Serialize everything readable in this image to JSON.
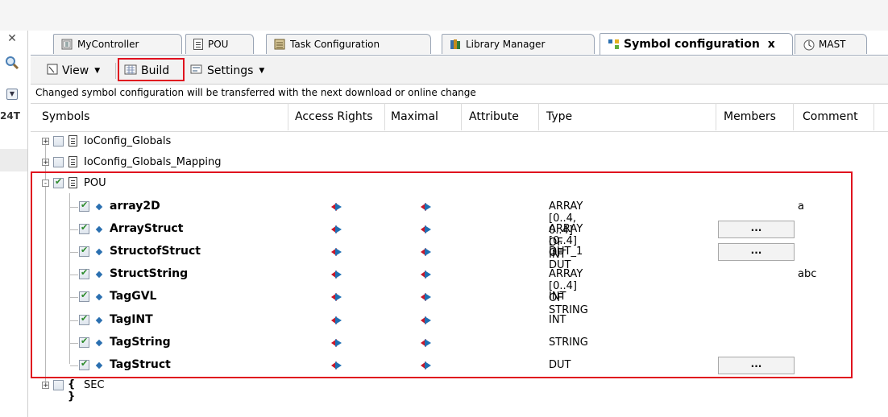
{
  "left_strip": {
    "number": "24T"
  },
  "tabs": [
    {
      "label": "MyController",
      "icon": "controller-icon"
    },
    {
      "label": "POU",
      "icon": "document-icon"
    },
    {
      "label": "Task Configuration",
      "icon": "task-config-icon"
    },
    {
      "label": "Library Manager",
      "icon": "library-icon"
    },
    {
      "label": "Symbol configuration",
      "icon": "symbol-config-icon",
      "active": true,
      "close": "x"
    },
    {
      "label": "MAST",
      "icon": "task-icon"
    }
  ],
  "toolbar": {
    "view_label": "View",
    "build_label": "Build",
    "settings_label": "Settings"
  },
  "notice": "Changed symbol configuration will be transferred with the next download or online change",
  "columns": [
    "Symbols",
    "Access Rights",
    "Maximal",
    "Attribute",
    "Type",
    "Members",
    "Comment"
  ],
  "groups": [
    {
      "label": "IoConfig_Globals",
      "expander": "+"
    },
    {
      "label": "IoConfig_Globals_Mapping",
      "expander": "+"
    },
    {
      "label": "POU",
      "expander": "-"
    }
  ],
  "variables": [
    {
      "name": "array2D",
      "type": "ARRAY [0..4, 0..4] OF INT",
      "members": false,
      "comment": "a"
    },
    {
      "name": "ArrayStruct",
      "type": "ARRAY [0..4] OF DUT",
      "members": true,
      "comment": ""
    },
    {
      "name": "StructofStruct",
      "type": "DUT_1",
      "members": true,
      "comment": ""
    },
    {
      "name": "StructString",
      "type": "ARRAY [0..4] OF STRING",
      "members": false,
      "comment": "abc"
    },
    {
      "name": "TagGVL",
      "type": "INT",
      "members": false,
      "comment": ""
    },
    {
      "name": "TagINT",
      "type": "INT",
      "members": false,
      "comment": ""
    },
    {
      "name": "TagString",
      "type": "STRING",
      "members": false,
      "comment": ""
    },
    {
      "name": "TagStruct",
      "type": "DUT",
      "members": true,
      "comment": ""
    }
  ],
  "members_button": "...",
  "sec": {
    "label": "SEC",
    "braces": "{ }",
    "expander": "+"
  },
  "colors": {
    "highlight": "#e0101e",
    "checkmark": "#2b8a2b",
    "var_icon": "#2a6fb0"
  }
}
